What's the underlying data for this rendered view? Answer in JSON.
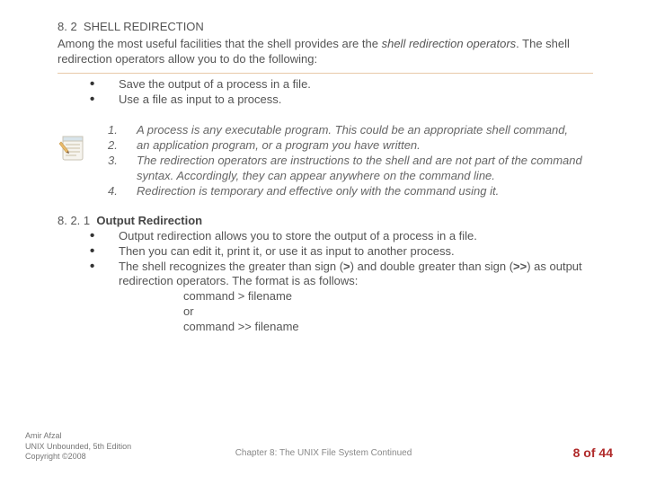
{
  "section": {
    "num": "8. 2",
    "title": "SHELL REDIRECTION",
    "intro_pre": "Among the most useful facilities that the shell provides are the ",
    "intro_em": "shell redirection operators",
    "intro_post": ". The shell redirection operators allow you to do the following:",
    "bullets": [
      "Save the output of a process in a file.",
      "Use a file as input to a process."
    ]
  },
  "notes": [
    {
      "n": "1.",
      "t": "A process is any executable program. This could be an appropriate shell command,"
    },
    {
      "n": "2.",
      "t": "an application program, or a program you have written."
    },
    {
      "n": "3.",
      "t": "The redirection operators are instructions to the shell and are not part of the command syntax. Accordingly, they can appear anywhere on the command line."
    },
    {
      "n": "4.",
      "t": "Redirection is temporary and effective only with the command using it."
    }
  ],
  "sub": {
    "num": "8. 2. 1",
    "title": "Output Redirection",
    "b1": "Output redirection allows you to store the output of a process in a file.",
    "b2": "Then you can edit it, print it, or use it as input to another process.",
    "b3_pre": "The shell recognizes the greater than sign (",
    "b3_gt": ">",
    "b3_mid": ") and double greater than sign (",
    "b3_ggt": ">>",
    "b3_post": ") as output redirection operators. The format is as follows:",
    "cmd1": "command > filename",
    "or": "or",
    "cmd2": "command >> filename"
  },
  "footer": {
    "l1": "Amir Afzal",
    "l2": "UNIX Unbounded, 5th Edition",
    "l3": "Copyright ©2008",
    "center": "Chapter 8: The UNIX File System Continued",
    "page_cur": "8",
    "page_of": " of ",
    "page_tot": "44"
  },
  "icon_name": "notepad-icon"
}
